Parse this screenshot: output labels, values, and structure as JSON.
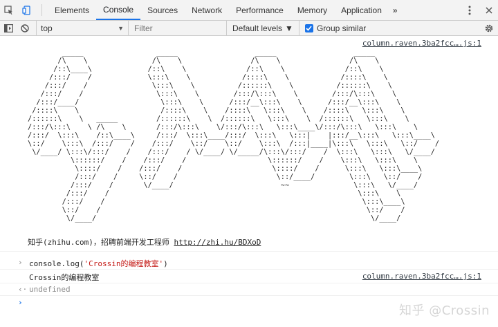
{
  "tabs": [
    {
      "label": "Elements",
      "active": false
    },
    {
      "label": "Console",
      "active": true
    },
    {
      "label": "Sources",
      "active": false
    },
    {
      "label": "Network",
      "active": false
    },
    {
      "label": "Performance",
      "active": false
    },
    {
      "label": "Memory",
      "active": false
    },
    {
      "label": "Application",
      "active": false
    }
  ],
  "more_tabs_label": "»",
  "toolbar": {
    "context_value": "top",
    "filter_placeholder": "Filter",
    "levels_label": "Default levels",
    "group_label": "Group similar",
    "group_checked": true
  },
  "console": {
    "source_link_1": "column.raven.3ba2fcc….js:1",
    "ascii_art": "        _____                 _____                  _____                  _____\n       /\\    \\               /\\    \\                /\\    \\                /\\    \\\n      /::\\____\\             /::\\    \\              /::\\    \\              /::\\    \\\n     /:::/    /             \\:::\\    \\            /::::\\    \\            /::::\\    \\\n    /:::/    /               \\:::\\    \\          /::::::\\    \\          /::::::\\    \\\n   /:::/    /                 \\:::\\    \\        /:::/\\:::\\    \\        /:::/\\:::\\    \\\n  /:::/____/                   \\:::\\    \\      /:::/__\\:::\\    \\      /:::/__\\:::\\    \\\n /::::\\    \\                   /::::\\    \\    /::::\\   \\:::\\    \\    /::::\\   \\:::\\    \\\n/::::::\\    \\   _____         /::::::\\    \\  /::::::\\   \\:::\\    \\  /::::::\\   \\:::\\    \\\n/:::/\\:::\\    \\ /\\    \\       /:::/\\:::\\    \\/:::/\\:::\\   \\:::\\____\\/:::/\\:::\\   \\:::\\    \\\n/:::/  \\:::\\    /::\\____\\     /:::/  \\:::\\____/:::/  \\:::\\   \\:::|    |:::/__\\:::\\   \\:::\\____\\\n\\::/    \\:::\\  /:::/    /    /:::/    \\::/    \\::/    \\:::\\  /:::|____|\\:::\\   \\:::\\   \\::/    /\n \\/____/ \\:::\\/:::/    /    /:::/    / \\/____/ \\/_____/\\:::\\/:::/    /  \\:::\\   \\:::\\   \\/____/\n          \\::::::/    /    /:::/    /                   \\::::::/    /    \\:::\\   \\:::\\    \\\n           \\::::/    /    /:::/    /                     \\::::/    /      \\:::\\   \\:::\\____\\\n           /:::/    /     \\::/    /                       \\::/____/        \\:::\\   \\::/    /\n          /:::/    /       \\/____/                         ~~               \\:::\\   \\/____/\n         /:::/    /                                                          \\:::\\    \\\n        /:::/    /                                                            \\:::\\____\\\n        \\::/    /                                                              \\::/    /\n         \\/____/                                                                \\/____/",
    "note_text": "知乎(zhihu.com)，招聘前端开发工程师 ",
    "note_link": "http://zhi.hu/BDXoD",
    "command_prefix": "console.log(",
    "command_string": "'Crossin的编程教室'",
    "command_suffix": ")",
    "output_text": "Crossin的编程教室",
    "source_link_2": "column.raven.3ba2fcc….js:1",
    "return_value": "undefined"
  },
  "watermark": "知乎 @Crossin",
  "colors": {
    "accent": "#1a73e8",
    "string": "#c41a16"
  }
}
